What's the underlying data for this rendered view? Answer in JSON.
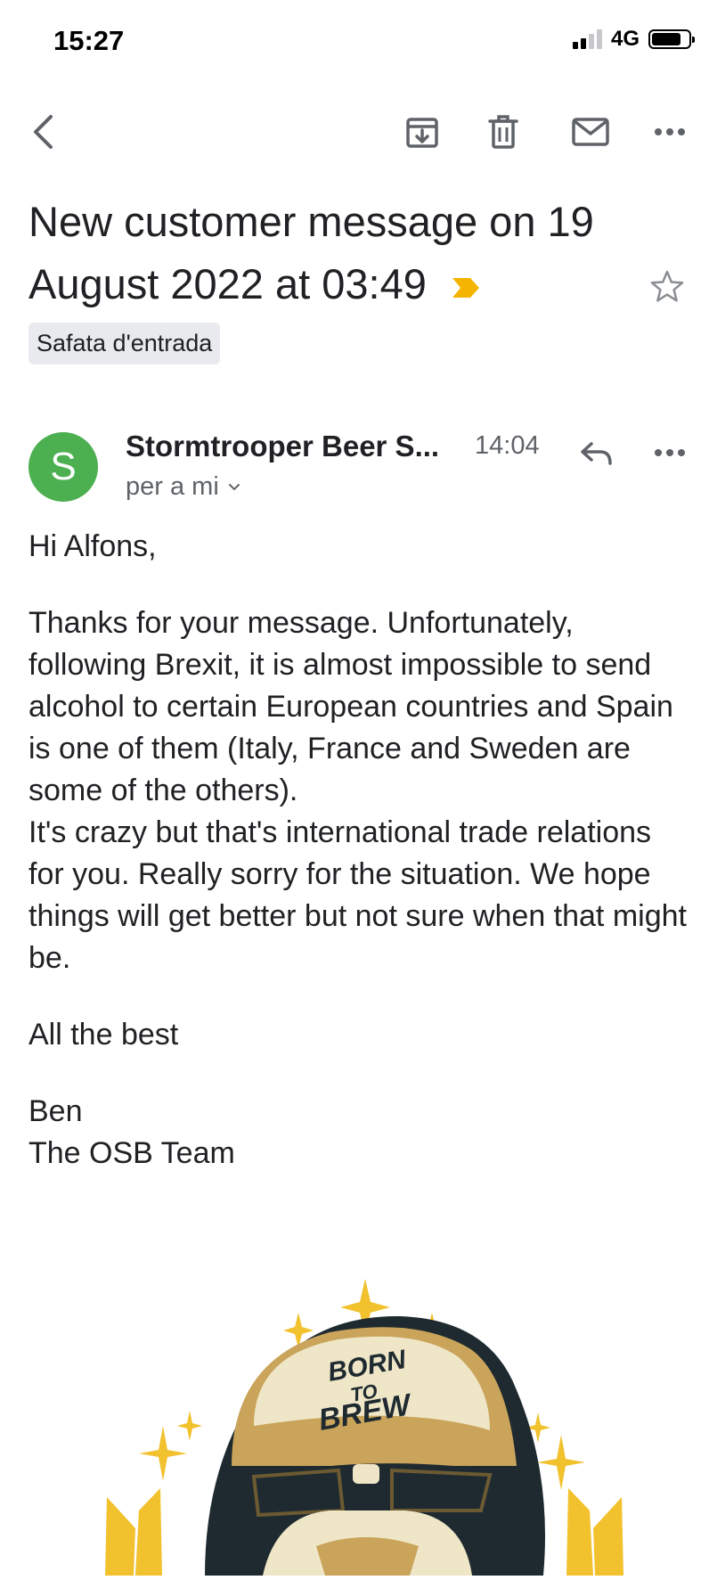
{
  "status_bar": {
    "time": "15:27",
    "network": "4G"
  },
  "toolbar": {
    "icons": [
      "back-icon",
      "archive-icon",
      "trash-icon",
      "mail-icon",
      "more-icon"
    ]
  },
  "email": {
    "subject": "New customer message on 19 August 2022 at 03:49",
    "label": "Safata d'entrada",
    "sender_initial": "S",
    "sender_name": "Stormtrooper Beer S...",
    "time": "14:04",
    "recipient": "per a mi",
    "body": {
      "greeting": "Hi Alfons,",
      "paragraph_1": "Thanks for your message. Unfortunately, following Brexit, it is almost impossible to send alcohol to certain European countries and Spain is one of them (Italy, France and Sweden are some of the others).",
      "paragraph_2": "It's crazy but that's international trade relations for you. Really sorry for the situation. We hope things will get better but not sure when that might be.",
      "closing": "All the best",
      "signature_name": "Ben",
      "signature_team": "The OSB Team"
    }
  },
  "logo": {
    "line_1": "BORN",
    "line_2": "TO",
    "line_3": "BREW"
  },
  "colors": {
    "avatar": "#4caf50",
    "importance_marker": "#f4b400",
    "label_chip": "#e8eaed",
    "logo_gold": "#f2c12e",
    "logo_dark": "#1f2a30",
    "logo_cream": "#efe6c8"
  }
}
